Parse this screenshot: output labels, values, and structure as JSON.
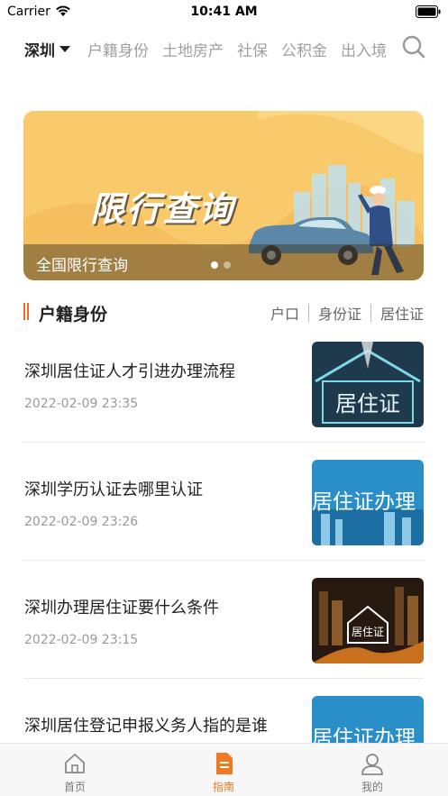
{
  "status_bar": {
    "carrier": "Carrier",
    "time": "10:41 AM"
  },
  "nav": {
    "city": "深圳",
    "categories": [
      "户籍身份",
      "土地房产",
      "社保",
      "公积金",
      "出入境"
    ]
  },
  "banner": {
    "image_text": "限行查询",
    "caption": "全国限行查询",
    "slide_count": 2,
    "active_slide": 1
  },
  "section": {
    "title": "户籍身份",
    "tabs": [
      "户口",
      "身份证",
      "居住证"
    ]
  },
  "articles": [
    {
      "title": "深圳居住证人才引进办理流程",
      "date": "2022-02-09 23:35",
      "thumb_text": "居住证"
    },
    {
      "title": "深圳学历认证去哪里认证",
      "date": "2022-02-09 23:26",
      "thumb_text": "居住证办理"
    },
    {
      "title": "深圳办理居住证要什么条件",
      "date": "2022-02-09 23:15",
      "thumb_text": "居住证"
    },
    {
      "title": "深圳居住登记申报义务人指的是谁",
      "date": "",
      "thumb_text": "居住证办理"
    }
  ],
  "tabbar": {
    "items": [
      {
        "label": "首页",
        "icon": "home-icon"
      },
      {
        "label": "指南",
        "icon": "guide-icon"
      },
      {
        "label": "我的",
        "icon": "profile-icon"
      }
    ],
    "active": "指南"
  },
  "colors": {
    "accent": "#f07a22",
    "banner_bg": "#f8ca6c"
  }
}
